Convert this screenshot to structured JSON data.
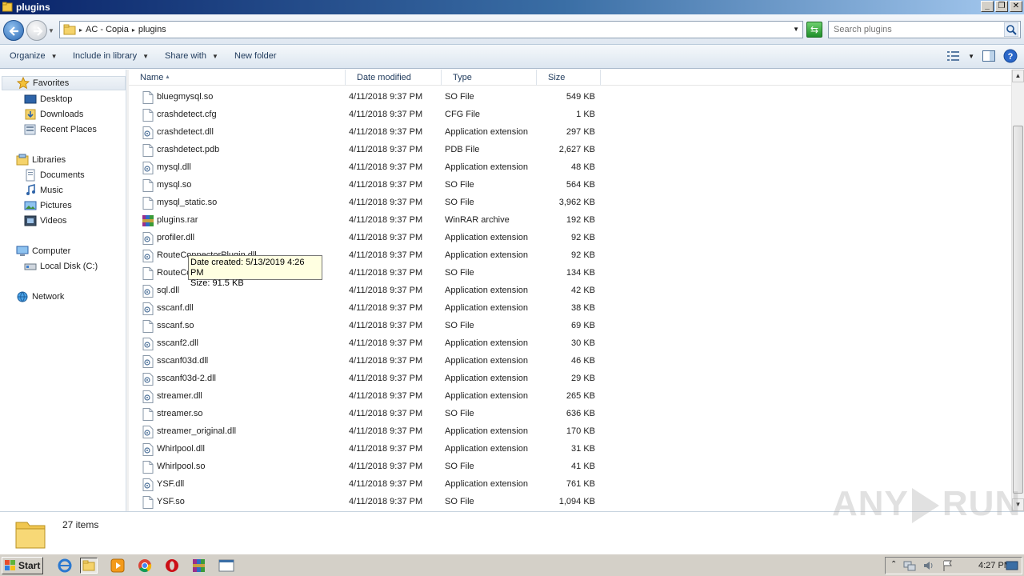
{
  "window": {
    "title": "plugins"
  },
  "address": {
    "crumbs": [
      "AC - Copia",
      "plugins"
    ]
  },
  "search": {
    "placeholder": "Search plugins"
  },
  "toolbar": {
    "organize": "Organize",
    "include_in_library": "Include in library",
    "share_with": "Share with",
    "new_folder": "New folder"
  },
  "nav": {
    "favorites": "Favorites",
    "desktop": "Desktop",
    "downloads": "Downloads",
    "recent_places": "Recent Places",
    "libraries": "Libraries",
    "documents": "Documents",
    "music": "Music",
    "pictures": "Pictures",
    "videos": "Videos",
    "computer": "Computer",
    "local_disk": "Local Disk (C:)",
    "network": "Network"
  },
  "columns": {
    "name": "Name",
    "date": "Date modified",
    "type": "Type",
    "size": "Size"
  },
  "files": [
    {
      "name": "bluegmysql.so",
      "date": "4/11/2018 9:37 PM",
      "type": "SO File",
      "size": "549 KB",
      "icon": "generic-file-icon"
    },
    {
      "name": "crashdetect.cfg",
      "date": "4/11/2018 9:37 PM",
      "type": "CFG File",
      "size": "1 KB",
      "icon": "generic-file-icon"
    },
    {
      "name": "crashdetect.dll",
      "date": "4/11/2018 9:37 PM",
      "type": "Application extension",
      "size": "297 KB",
      "icon": "dll-icon"
    },
    {
      "name": "crashdetect.pdb",
      "date": "4/11/2018 9:37 PM",
      "type": "PDB File",
      "size": "2,627 KB",
      "icon": "generic-file-icon"
    },
    {
      "name": "mysql.dll",
      "date": "4/11/2018 9:37 PM",
      "type": "Application extension",
      "size": "48 KB",
      "icon": "dll-icon"
    },
    {
      "name": "mysql.so",
      "date": "4/11/2018 9:37 PM",
      "type": "SO File",
      "size": "564 KB",
      "icon": "generic-file-icon"
    },
    {
      "name": "mysql_static.so",
      "date": "4/11/2018 9:37 PM",
      "type": "SO File",
      "size": "3,962 KB",
      "icon": "generic-file-icon"
    },
    {
      "name": "plugins.rar",
      "date": "4/11/2018 9:37 PM",
      "type": "WinRAR archive",
      "size": "192 KB",
      "icon": "rar-icon"
    },
    {
      "name": "profiler.dll",
      "date": "4/11/2018 9:37 PM",
      "type": "Application extension",
      "size": "92 KB",
      "icon": "dll-icon"
    },
    {
      "name": "RouteConnectorPlugin.dll",
      "date": "4/11/2018 9:37 PM",
      "type": "Application extension",
      "size": "92 KB",
      "icon": "dll-icon"
    },
    {
      "name": "RouteConnectorPlugin.so",
      "date": "4/11/2018 9:37 PM",
      "type": "SO File",
      "size": "134 KB",
      "icon": "generic-file-icon"
    },
    {
      "name": "sql.dll",
      "date": "4/11/2018 9:37 PM",
      "type": "Application extension",
      "size": "42 KB",
      "icon": "dll-icon"
    },
    {
      "name": "sscanf.dll",
      "date": "4/11/2018 9:37 PM",
      "type": "Application extension",
      "size": "38 KB",
      "icon": "dll-icon"
    },
    {
      "name": "sscanf.so",
      "date": "4/11/2018 9:37 PM",
      "type": "SO File",
      "size": "69 KB",
      "icon": "generic-file-icon"
    },
    {
      "name": "sscanf2.dll",
      "date": "4/11/2018 9:37 PM",
      "type": "Application extension",
      "size": "30 KB",
      "icon": "dll-icon"
    },
    {
      "name": "sscanf03d.dll",
      "date": "4/11/2018 9:37 PM",
      "type": "Application extension",
      "size": "46 KB",
      "icon": "dll-icon"
    },
    {
      "name": "sscanf03d-2.dll",
      "date": "4/11/2018 9:37 PM",
      "type": "Application extension",
      "size": "29 KB",
      "icon": "dll-icon"
    },
    {
      "name": "streamer.dll",
      "date": "4/11/2018 9:37 PM",
      "type": "Application extension",
      "size": "265 KB",
      "icon": "dll-icon"
    },
    {
      "name": "streamer.so",
      "date": "4/11/2018 9:37 PM",
      "type": "SO File",
      "size": "636 KB",
      "icon": "generic-file-icon"
    },
    {
      "name": "streamer_original.dll",
      "date": "4/11/2018 9:37 PM",
      "type": "Application extension",
      "size": "170 KB",
      "icon": "dll-icon"
    },
    {
      "name": "Whirlpool.dll",
      "date": "4/11/2018 9:37 PM",
      "type": "Application extension",
      "size": "31 KB",
      "icon": "dll-icon"
    },
    {
      "name": "Whirlpool.so",
      "date": "4/11/2018 9:37 PM",
      "type": "SO File",
      "size": "41 KB",
      "icon": "generic-file-icon"
    },
    {
      "name": "YSF.dll",
      "date": "4/11/2018 9:37 PM",
      "type": "Application extension",
      "size": "761 KB",
      "icon": "dll-icon"
    },
    {
      "name": "YSF.so",
      "date": "4/11/2018 9:37 PM",
      "type": "SO File",
      "size": "1,094 KB",
      "icon": "generic-file-icon"
    }
  ],
  "tooltip": {
    "line1": "Date created: 5/13/2019 4:26 PM",
    "line2": "Size: 91.5 KB"
  },
  "details": {
    "count": "27 items"
  },
  "watermark": {
    "left": "ANY",
    "right": "RUN"
  },
  "taskbar": {
    "start": "Start",
    "time": "4:27 PM"
  },
  "colors": {
    "title_gradient_start": "#0a246a",
    "selection": "#e2e9f1",
    "tooltip_bg": "#ffffe1"
  }
}
